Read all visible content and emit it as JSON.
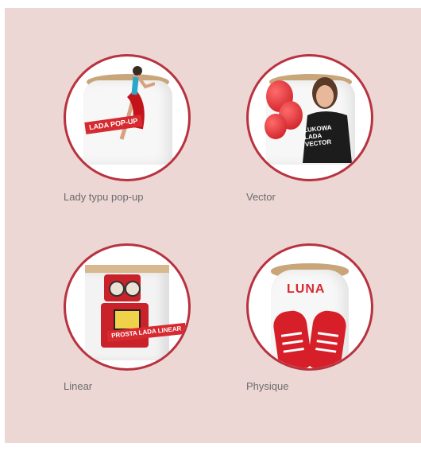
{
  "products": [
    {
      "id": "lady-typu-pop-up",
      "label": "Lady typu pop-up",
      "image_text": "LADA POP-UP",
      "image_alt": "curved pop-up counter with dancer graphic"
    },
    {
      "id": "vector",
      "label": "Vector",
      "image_text": "ŁUKOWA LADA VECTOR",
      "image_alt": "curved counter with woman and red balloons"
    },
    {
      "id": "linear",
      "label": "Linear",
      "image_text": "PROSTA LADA LINEAR",
      "image_alt": "straight counter with red robot graphic"
    },
    {
      "id": "physique",
      "label": "Physique",
      "image_text": "LUNA",
      "image_alt": "oval counter with red sneakers"
    }
  ],
  "colors": {
    "panel_background": "#ecd7d5",
    "circle_border": "#b8323f",
    "label_text": "#6b6b6b",
    "brand_red": "#d62a30"
  }
}
